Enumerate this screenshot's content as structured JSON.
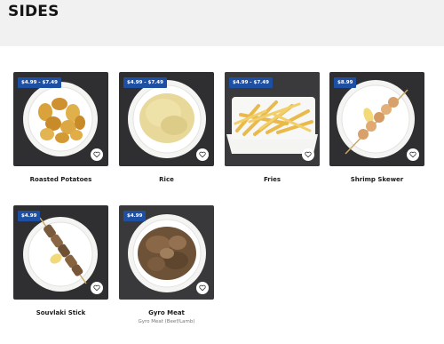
{
  "page": {
    "title": "SIDES"
  },
  "colors": {
    "price_badge": "#1d4fa3",
    "tile_bg": "#2f2f31",
    "header_bg": "#f1f1f1"
  },
  "items": [
    {
      "name": "Roasted Potatoes",
      "price": "$4.99 - $7.49",
      "favorite_icon": "heart-icon"
    },
    {
      "name": "Rice",
      "price": "$4.99 - $7.49",
      "favorite_icon": "heart-icon"
    },
    {
      "name": "Fries",
      "price": "$4.99 - $7.49",
      "favorite_icon": "heart-icon"
    },
    {
      "name": "Shrimp Skewer",
      "price": "$8.99",
      "favorite_icon": "heart-icon"
    },
    {
      "name": "Souvlaki Stick",
      "price": "$4.99",
      "favorite_icon": "heart-icon"
    },
    {
      "name": "Gyro Meat",
      "price": "$4.99",
      "subtitle": "Gyro Meat (Beef/Lamb)",
      "favorite_icon": "heart-icon"
    }
  ]
}
